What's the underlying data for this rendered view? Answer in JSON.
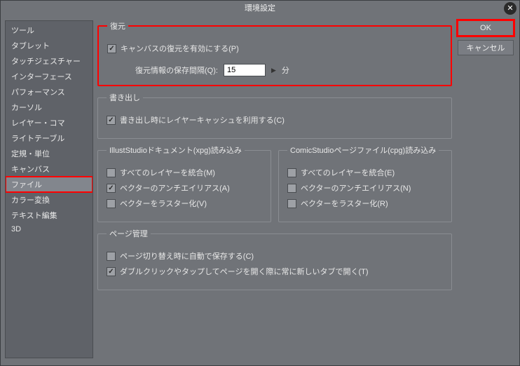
{
  "title": "環境設定",
  "sidebar": {
    "items": [
      "ツール",
      "タブレット",
      "タッチジェスチャー",
      "インターフェース",
      "パフォーマンス",
      "カーソル",
      "レイヤー・コマ",
      "ライトテーブル",
      "定規・単位",
      "キャンバス",
      "ファイル",
      "カラー変換",
      "テキスト編集",
      "3D"
    ]
  },
  "buttons": {
    "ok": "OK",
    "cancel": "キャンセル"
  },
  "restore": {
    "legend": "復元",
    "enable": "キャンバスの復元を有効にする(P)",
    "interval_label": "復元情報の保存間隔(Q):",
    "value": "15",
    "unit": "分"
  },
  "export": {
    "legend": "書き出し",
    "use_cache": "書き出し時にレイヤーキャッシュを利用する(C)"
  },
  "illust": {
    "legend": "IllustStudioドキュメント(xpg)読み込み",
    "merge": "すべてのレイヤーを統合(M)",
    "aa": "ベクターのアンチエイリアス(A)",
    "raster": "ベクターをラスター化(V)"
  },
  "comic": {
    "legend": "ComicStudioページファイル(cpg)読み込み",
    "merge": "すべてのレイヤーを統合(E)",
    "aa": "ベクターのアンチエイリアス(N)",
    "raster": "ベクターをラスター化(R)"
  },
  "page": {
    "legend": "ページ管理",
    "autosave": "ページ切り替え時に自動で保存する(C)",
    "newtab": "ダブルクリックやタップしてページを開く際に常に新しいタブで開く(T)"
  }
}
